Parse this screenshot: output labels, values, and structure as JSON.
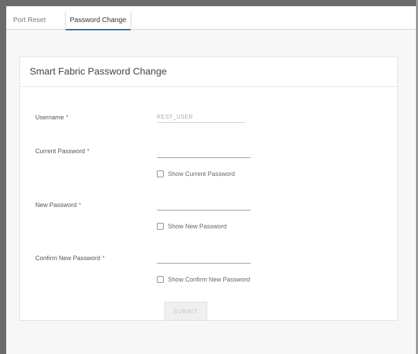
{
  "tabs": [
    {
      "label": "Port Reset",
      "active": false
    },
    {
      "label": "Password Change",
      "active": true
    }
  ],
  "form": {
    "title": "Smart Fabric Password Change",
    "required_marker": "*",
    "username": {
      "label": "Username",
      "value": "REST_USER"
    },
    "current_password": {
      "label": "Current Password",
      "value": "",
      "show_label": "Show Current Password",
      "show_checked": false
    },
    "new_password": {
      "label": "New Password",
      "value": "",
      "show_label": "Show New Password",
      "show_checked": false
    },
    "confirm_password": {
      "label": "Confirm New Password",
      "value": "",
      "show_label": "Show Confirm New Password",
      "show_checked": false
    },
    "submit_label": "SUBMIT",
    "submit_enabled": false
  },
  "colors": {
    "accent": "#1c6fb0",
    "required": "#d9534f",
    "frame": "#6b6b6b"
  }
}
